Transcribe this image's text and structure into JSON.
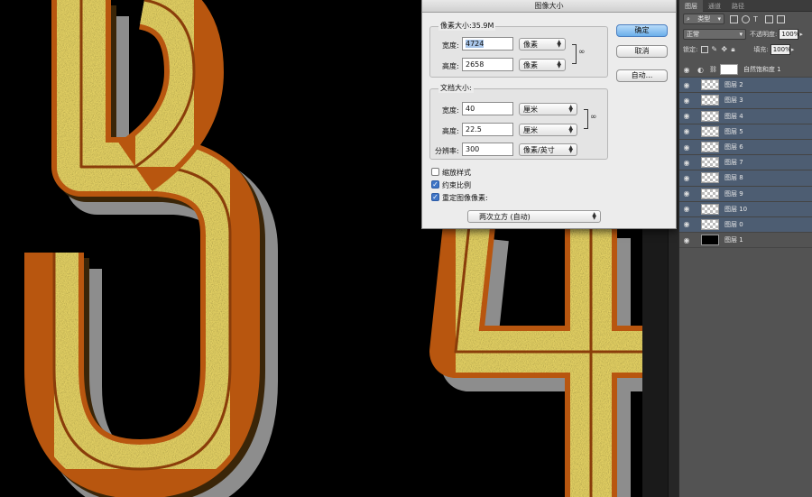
{
  "canvas": {
    "glyphs": [
      "3",
      "4"
    ]
  },
  "dialog": {
    "title": "图像大小",
    "pixel_dimensions": {
      "label": "像素大小:35.9M",
      "width_label": "宽度:",
      "width_value": "4724",
      "width_unit": "像素",
      "height_label": "高度:",
      "height_value": "2658",
      "height_unit": "像素"
    },
    "document_size": {
      "label": "文档大小:",
      "width_label": "宽度:",
      "width_value": "40",
      "width_unit": "厘米",
      "height_label": "高度:",
      "height_value": "22.5",
      "height_unit": "厘米",
      "resolution_label": "分辨率:",
      "resolution_value": "300",
      "resolution_unit": "像素/英寸"
    },
    "options": [
      {
        "label": "缩放样式",
        "checked": false
      },
      {
        "label": "约束比例",
        "checked": true
      },
      {
        "label": "重定图像像素:",
        "checked": true
      }
    ],
    "resample_method": "两次立方 (自动)",
    "buttons": {
      "ok": "确定",
      "cancel": "取消",
      "auto": "自动..."
    }
  },
  "layers_panel": {
    "tabs": [
      "图层",
      "通道",
      "路径"
    ],
    "filter_kind": "类型",
    "blend_mode": "正常",
    "opacity_label": "不透明度:",
    "opacity_value": "100%",
    "lock_label": "锁定:",
    "fill_label": "填充:",
    "fill_value": "100%",
    "layers": [
      {
        "name": "自然饱和度 1",
        "thumb": "white",
        "selected": false
      },
      {
        "name": "图层 2",
        "thumb": "checker",
        "selected": true
      },
      {
        "name": "图层 3",
        "thumb": "checker",
        "selected": true
      },
      {
        "name": "图层 4",
        "thumb": "checker",
        "selected": true
      },
      {
        "name": "图层 5",
        "thumb": "checker",
        "selected": true
      },
      {
        "name": "图层 6",
        "thumb": "checker",
        "selected": true
      },
      {
        "name": "图层 7",
        "thumb": "checker",
        "selected": true
      },
      {
        "name": "图层 8",
        "thumb": "checker",
        "selected": true
      },
      {
        "name": "图层 9",
        "thumb": "checker",
        "selected": true
      },
      {
        "name": "图层 10",
        "thumb": "checker",
        "selected": true
      },
      {
        "name": "图层 0",
        "thumb": "checker",
        "selected": true
      },
      {
        "name": "图层 1",
        "thumb": "black",
        "selected": false
      }
    ]
  },
  "colors": {
    "glyph_fill": "#f2de6a",
    "glyph_edge": "#b8560f",
    "glyph_side": "#8d8d8d",
    "selection": "#4d5d72",
    "panel_bg": "#535353"
  }
}
